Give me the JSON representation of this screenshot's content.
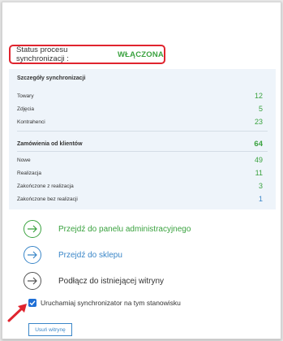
{
  "status": {
    "label": "Status procesu synchronizacji :",
    "value": "WŁĄCZONA"
  },
  "sync_details": {
    "title": "Szczegóły synchronizacji",
    "rows": [
      {
        "label": "Towary",
        "value": "12"
      },
      {
        "label": "Zdjęcia",
        "value": "5"
      },
      {
        "label": "Kontrahenci",
        "value": "23"
      }
    ]
  },
  "orders": {
    "title": "Zamówienia od klientów",
    "total": "64",
    "rows": [
      {
        "label": "Nowe",
        "value": "49"
      },
      {
        "label": "Realizacja",
        "value": "11"
      },
      {
        "label": "Zakończone z realizacja",
        "value": "3"
      },
      {
        "label": "Zakończone bez realizacji",
        "value": "1"
      }
    ]
  },
  "actions": [
    {
      "label": "Przejdź do panelu administracyjnego",
      "icon": "arrow-right-circle-icon",
      "color": "#3aa23f"
    },
    {
      "label": "Przejdź do sklepu",
      "icon": "arrow-right-circle-icon",
      "color": "#3a86c8"
    },
    {
      "label": "Podłącz do istniejącej witryny",
      "icon": "arrow-right-circle-icon",
      "color": "#555555"
    }
  ],
  "checkbox": {
    "label": "Uruchamiaj synchronizator na tym stanowisku",
    "checked": true
  },
  "remove_button": {
    "label": "Usuń witrynę"
  },
  "colors": {
    "accent_green": "#3aa23f",
    "accent_blue": "#3a86c8",
    "highlight_red": "#e0242e"
  }
}
